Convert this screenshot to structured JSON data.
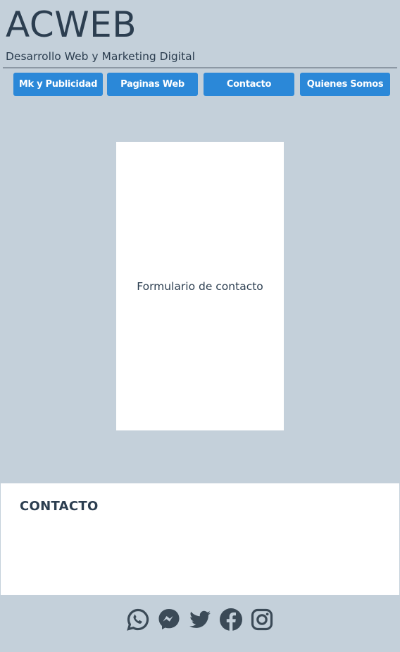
{
  "header": {
    "title": "ACWEB",
    "subtitle": "Desarrollo Web y Marketing Digital"
  },
  "nav": {
    "items": [
      {
        "label": "Mk y Publicidad"
      },
      {
        "label": "Paginas Web"
      },
      {
        "label": "Contacto"
      },
      {
        "label": "Quienes Somos"
      }
    ]
  },
  "form": {
    "label": "Formulario de contacto"
  },
  "contact": {
    "heading": "CONTACTO"
  },
  "social": {
    "icons": [
      "whatsapp-icon",
      "messenger-icon",
      "twitter-icon",
      "facebook-icon",
      "instagram-icon"
    ]
  },
  "colors": {
    "background": "#c4d0da",
    "text": "#2c3e50",
    "accent": "#2b88d8",
    "panel": "#ffffff",
    "icon": "#3b4a57"
  }
}
